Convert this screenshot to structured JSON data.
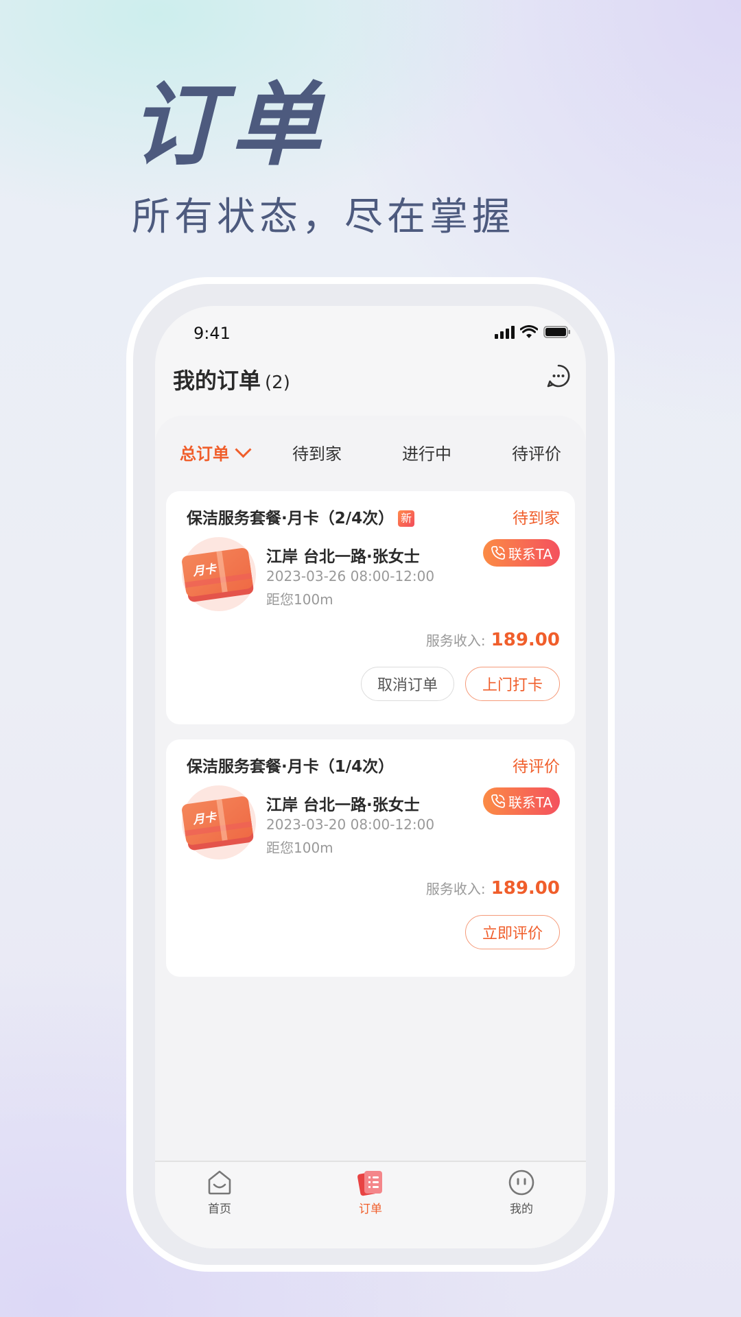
{
  "hero": {
    "title": "订单",
    "subtitle": "所有状态，尽在掌握"
  },
  "status_bar": {
    "time": "9:41",
    "icons": [
      "signal-icon",
      "wifi-icon",
      "battery-icon"
    ]
  },
  "header": {
    "title": "我的订单",
    "count": "(2)",
    "message_icon": "message-icon"
  },
  "tabs": [
    {
      "label": "总订单",
      "active": true
    },
    {
      "label": "待到家",
      "active": false
    },
    {
      "label": "进行中",
      "active": false
    },
    {
      "label": "待评价",
      "active": false
    }
  ],
  "orders": [
    {
      "title": "保洁服务套餐·月卡（2/4次）",
      "badge": "新",
      "status": "待到家",
      "card_text": "月卡",
      "address": "江岸 台北一路·张女士",
      "datetime": "2023-03-26   08:00-12:00",
      "distance": "距您100m",
      "contact_label": "联系TA",
      "income_label": "服务收入:",
      "income_value": "189.00",
      "buttons": [
        "取消订单",
        "上门打卡"
      ]
    },
    {
      "title": "保洁服务套餐·月卡（1/4次）",
      "status": "待评价",
      "card_text": "月卡",
      "address": "江岸 台北一路·张女士",
      "datetime": "2023-03-20   08:00-12:00",
      "distance": "距您100m",
      "contact_label": "联系TA",
      "income_label": "服务收入:",
      "income_value": "189.00",
      "buttons": [
        "立即评价"
      ]
    }
  ],
  "tabbar": [
    {
      "label": "首页",
      "icon": "home-icon",
      "active": false
    },
    {
      "label": "订单",
      "icon": "orders-icon",
      "active": true
    },
    {
      "label": "我的",
      "icon": "profile-icon",
      "active": false
    }
  ],
  "colors": {
    "accent": "#f05e2b",
    "hero_text": "#4d5a7e"
  }
}
